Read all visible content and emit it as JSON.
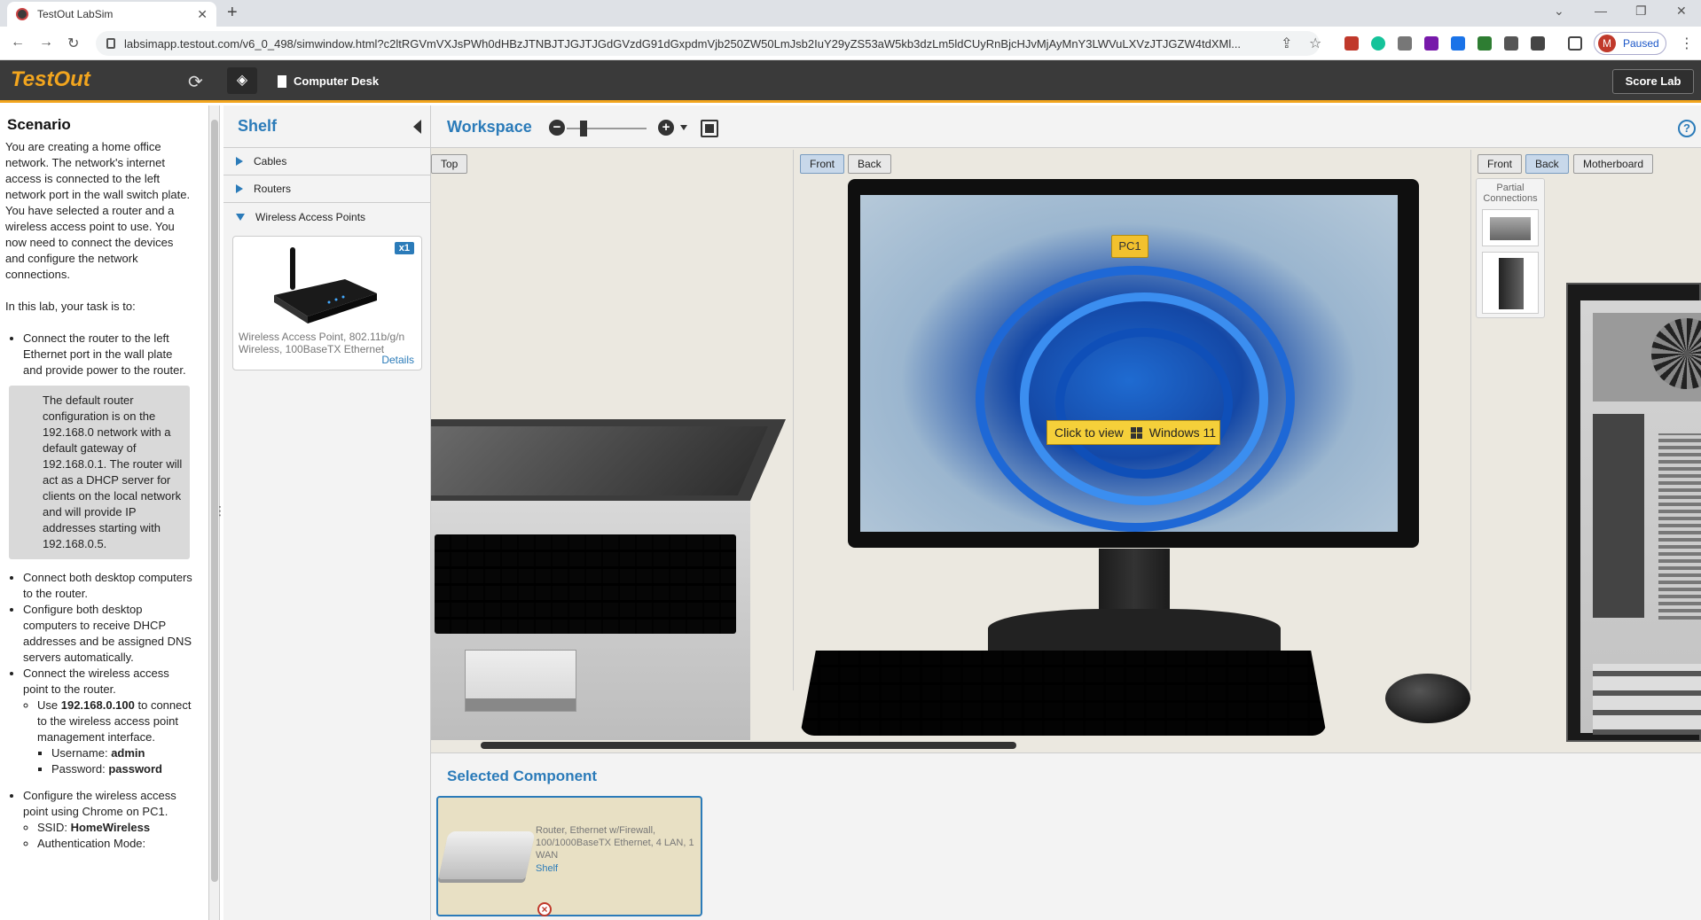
{
  "browser": {
    "tab_title": "TestOut LabSim",
    "url": "labsimapp.testout.com/v6_0_498/simwindow.html?c2ltRGVmVXJsPWh0dHBzJTNBJTJGJTJGdGVzdG91dGxpdmVjb250ZW50LmJsb2IuY29yZS53aW5kb3dzLm5ldCUyRnBjcHJvMjAyMnY3LWVuLXVzJTJGZW4tdXMl...",
    "profile_initial": "M",
    "profile_status": "Paused"
  },
  "app": {
    "logo": "TestOut",
    "location": "Computer Desk",
    "score_button": "Score Lab"
  },
  "scenario": {
    "title": "Scenario",
    "intro": "You are creating a home office network. The network's internet access is connected to the left network port in the wall switch plate. You have selected a router and a wireless access point to use. You now need to connect the devices and configure the network connections.",
    "task_lead": "In this lab, your task is to:",
    "task1": "Connect the router to the left Ethernet port in the wall plate and provide power to the router.",
    "info_box": "The default router configuration is on the 192.168.0 network with a default gateway of 192.168.0.1. The router will act as a DHCP server for clients on the local network and will provide IP addresses starting with 192.168.0.5.",
    "task2": "Connect both desktop computers to the router.",
    "task3": "Configure both desktop computers to receive DHCP addresses and be assigned DNS servers automatically.",
    "task4": "Connect the wireless access point to the router.",
    "task4_use_pre": "Use ",
    "task4_ip": "192.168.0.100",
    "task4_use_post": " to connect to the wireless access point management interface.",
    "username_label": "Username: ",
    "username_value": "admin",
    "password_label": "Password: ",
    "password_value": "password",
    "task5": "Configure the wireless access point using Chrome on PC1.",
    "ssid_label": "SSID: ",
    "ssid_value": "HomeWireless",
    "auth_label": "Authentication Mode:"
  },
  "shelf": {
    "title": "Shelf",
    "categories": [
      "Cables",
      "Routers",
      "Wireless Access Points"
    ],
    "item": {
      "qty": "x1",
      "description": "Wireless Access Point, 802.11b/g/n Wireless, 100BaseTX Ethernet",
      "details_link": "Details"
    }
  },
  "workspace": {
    "title": "Workspace",
    "views": {
      "top": "Top",
      "front": "Front",
      "back": "Back",
      "motherboard": "Motherboard",
      "partial_connections": "Partial Connections"
    },
    "pc_label": "PC1",
    "click_to_view": "Click to view",
    "os_name": "Windows 11",
    "help": "?"
  },
  "selected_component": {
    "title": "Selected Component",
    "description": "Router, Ethernet w/Firewall, 100/1000BaseTX Ethernet, 4 LAN, 1 WAN",
    "location": "Shelf"
  },
  "colors": {
    "accent": "#2b7bb9",
    "brand": "#f2a51e",
    "header_bg": "#3a3a3a"
  }
}
